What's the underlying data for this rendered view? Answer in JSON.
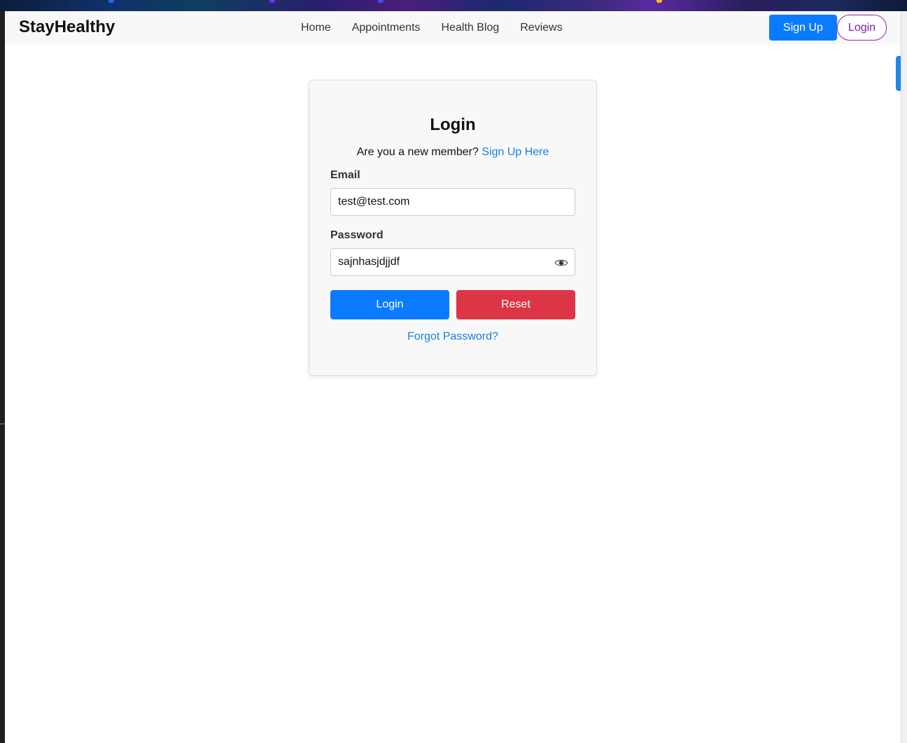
{
  "navbar": {
    "brand": "StayHealthy",
    "links": [
      "Home",
      "Appointments",
      "Health Blog",
      "Reviews"
    ],
    "signup_label": "Sign Up",
    "login_label": "Login"
  },
  "login_form": {
    "title": "Login",
    "member_prompt": "Are you a new member?",
    "signup_link": "Sign Up Here",
    "email_label": "Email",
    "email_value": "test@test.com",
    "password_label": "Password",
    "password_value": "sajnhasjdjjdf",
    "login_button": "Login",
    "reset_button": "Reset",
    "forgot_link": "Forgot Password?"
  },
  "colors": {
    "primary": "#0a7bff",
    "danger": "#dc3545",
    "link": "#1a7fe0",
    "login_outline": "#8e24aa"
  },
  "icons": {
    "password_toggle": "eye-icon"
  }
}
